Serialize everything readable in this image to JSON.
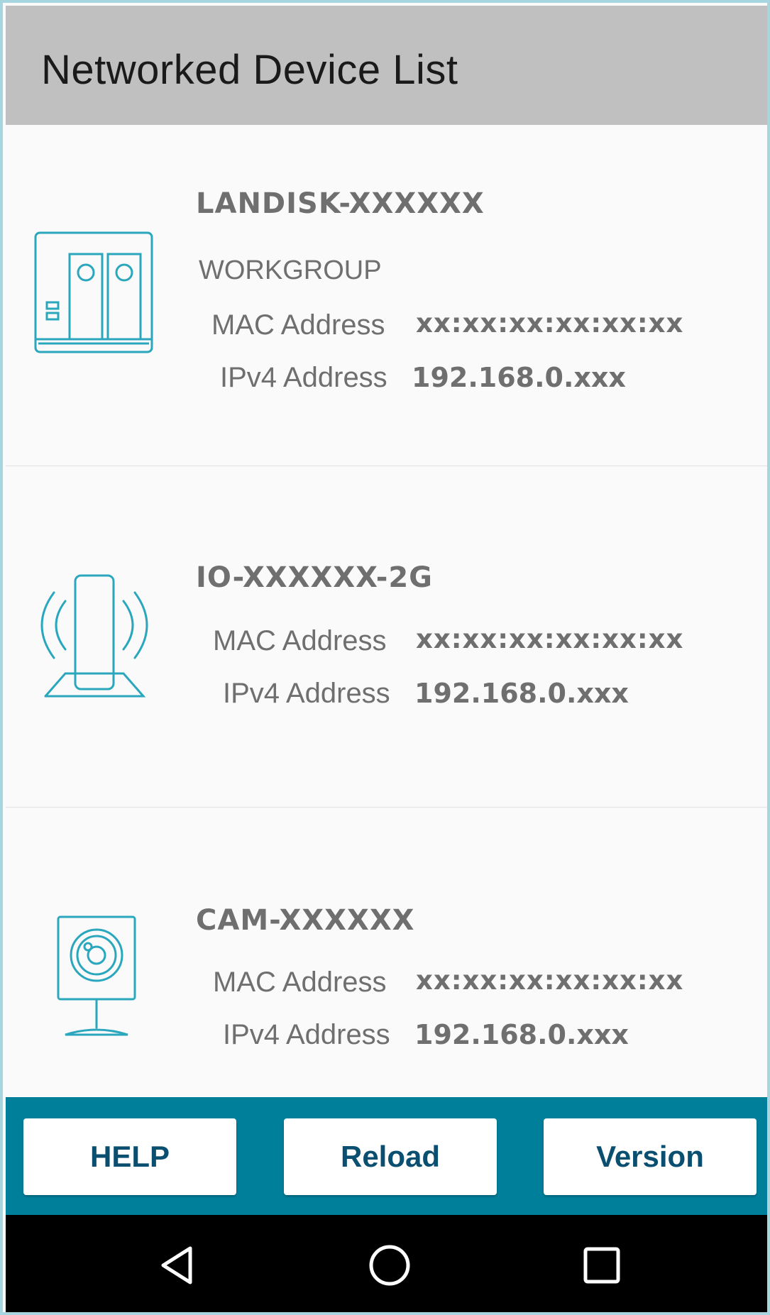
{
  "header": {
    "title": "Networked Device List"
  },
  "devices": [
    {
      "name": "LANDISK-XXXXXX",
      "workgroup": "WORKGROUP",
      "mac_label": "MAC Address",
      "mac_value": "xx:xx:xx:xx:xx:xx",
      "ip_label": "IPv4 Address",
      "ip_value": "192.168.0.xxx",
      "icon": "nas-icon"
    },
    {
      "name": "IO-XXXXXX-2G",
      "mac_label": "MAC Address",
      "mac_value": "xx:xx:xx:xx:xx:xx",
      "ip_label": "IPv4 Address",
      "ip_value": "192.168.0.xxx",
      "icon": "wireless-router-icon"
    },
    {
      "name": "CAM-XXXXXX",
      "mac_label": "MAC Address",
      "mac_value": "xx:xx:xx:xx:xx:xx",
      "ip_label": "IPv4 Address",
      "ip_value": "192.168.0.xxx",
      "icon": "camera-icon"
    }
  ],
  "toolbar": {
    "help_label": "HELP",
    "reload_label": "Reload",
    "version_label": "Version"
  },
  "navbar": {
    "back_icon": "back-triangle-icon",
    "home_icon": "home-circle-icon",
    "recents_icon": "recents-square-icon"
  },
  "colors": {
    "header_bg": "#c0c0c0",
    "accent": "#007f9b",
    "icon": "#2aa7bd",
    "button_text": "#0b4f70"
  }
}
